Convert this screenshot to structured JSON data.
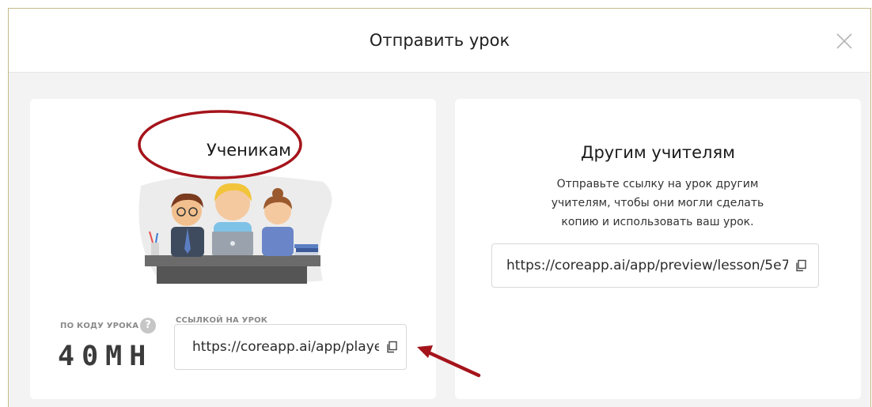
{
  "dialog": {
    "title": "Отправить урок",
    "close_icon": "close-icon"
  },
  "students": {
    "title": "Ученикам",
    "code_label": "ПО КОДУ УРОКА",
    "code_help": "?",
    "code": "40MH",
    "link_label": "ССЫЛКОЙ НА УРОК",
    "link_value": "https://coreapp.ai/app/player/",
    "copy_icon": "copy-icon"
  },
  "teachers": {
    "title": "Другим учителям",
    "description": "Отправьте ссылку на урок другим учителям, чтобы они могли сделать копию и использовать ваш урок.",
    "link_value": "https://coreapp.ai/app/preview/lesson/5e7",
    "copy_icon": "copy-icon"
  },
  "annotations": {
    "highlight_color": "#a5141b"
  }
}
